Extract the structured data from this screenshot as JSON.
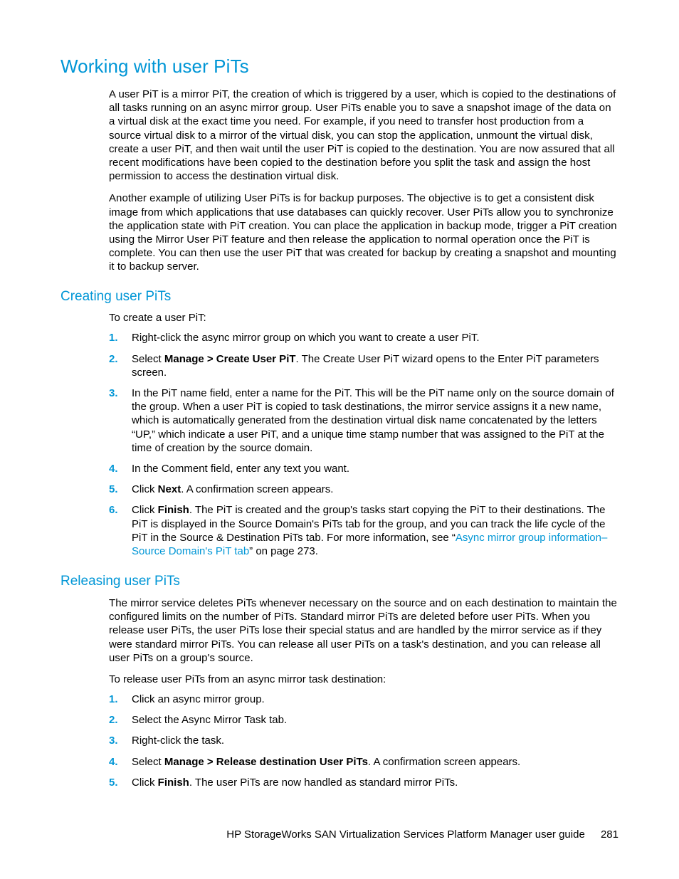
{
  "page": {
    "h1": "Working with user PiTs",
    "para1": "A user PiT is a mirror PiT, the creation of which is triggered by a user, which is copied to the destinations of all tasks running on an async mirror group. User PiTs enable you to save a snapshot image of the data on a virtual disk at the exact time you need. For example, if you need to transfer host production from a source virtual disk to a mirror of the virtual disk, you can stop the application, unmount the virtual disk, create a user PiT, and then wait until the user PiT is copied to the destination. You are now assured that all recent modifications have been copied to the destination before you split the task and assign the host permission to access the destination virtual disk.",
    "para2": "Another example of utilizing User PiTs is for backup purposes. The objective is to get a consistent disk image from which applications that use databases can quickly recover. User PiTs allow you to synchronize the application state with PiT creation. You can place the application in backup mode, trigger a PiT creation using the Mirror User PiT feature and then release the application to normal operation once the PiT is complete. You can then use the user PiT that was created for backup by creating a snapshot and mounting it to backup server.",
    "section_create": {
      "title": "Creating user PiTs",
      "intro": "To create a user PiT:",
      "steps": {
        "s1": "Right-click the async mirror group on which you want to create a user PiT.",
        "s2a": "Select ",
        "s2b": "Manage > Create User PiT",
        "s2c": ". The Create User PiT wizard opens to the Enter PiT parameters screen.",
        "s3": "In the PiT name field, enter a name for the PiT. This will be the PiT name only on the source domain of the group. When a user PiT is copied to task destinations, the mirror service assigns it a new name, which is automatically generated from the destination virtual disk name concatenated by the letters “UP,” which indicate a user PiT, and a unique time stamp number that was assigned to the PiT at the time of creation by the source domain.",
        "s4": "In the Comment field, enter any text you want.",
        "s5a": "Click ",
        "s5b": "Next",
        "s5c": ". A confirmation screen appears.",
        "s6a": "Click ",
        "s6b": "Finish",
        "s6c": ". The PiT is created and the group's tasks start copying the PiT to their destinations. The PiT is displayed in the Source Domain's PiTs tab for the group, and you can track the life cycle of the PiT in the Source & Destination PiTs tab. For more information, see “",
        "s6link": "Async mirror group information–Source Domain's PiT tab",
        "s6d": "” on page 273."
      }
    },
    "section_release": {
      "title": "Releasing user PiTs",
      "para": "The mirror service deletes PiTs whenever necessary on the source and on each destination to maintain the configured limits on the number of PiTs. Standard mirror PiTs are deleted before user PiTs. When you release user PiTs, the user PiTs lose their special status and are handled by the mirror service as if they were standard mirror PiTs. You can release all user PiTs on a task's destination, and you can release all user PiTs on a group's source.",
      "intro": "To release user PiTs from an async mirror task destination:",
      "steps": {
        "s1": "Click an async mirror group.",
        "s2": "Select the Async Mirror Task tab.",
        "s3": "Right-click the task.",
        "s4a": "Select ",
        "s4b": "Manage > Release destination User PiTs",
        "s4c": ". A confirmation screen appears.",
        "s5a": "Click ",
        "s5b": "Finish",
        "s5c": ". The user PiTs are now handled as standard mirror PiTs."
      }
    },
    "footer": {
      "title": "HP StorageWorks SAN Virtualization Services Platform Manager user guide",
      "page_num": "281"
    }
  }
}
